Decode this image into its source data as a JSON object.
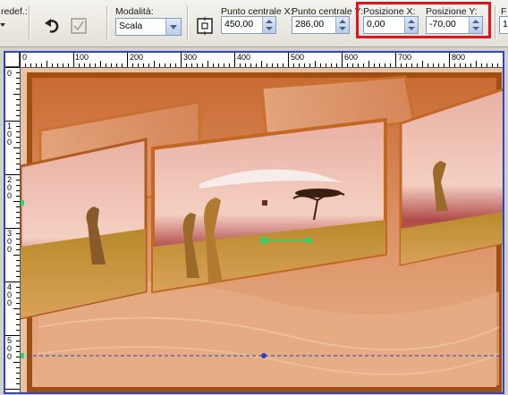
{
  "toolbar": {
    "preset_label": "redef.:",
    "mode_label": "Modalità:",
    "mode_value": "Scala",
    "center_x_label": "Punto centrale X:",
    "center_x_value": "450,00",
    "center_y_label": "Punto centrale Y:",
    "center_y_value": "286,00",
    "pos_x_label": "Posizione X:",
    "pos_x_value": "0,00",
    "pos_y_label": "Posizione Y:",
    "pos_y_value": "-70,00",
    "next_label": "F",
    "next_value": "1"
  },
  "ruler": {
    "h_ticks": [
      "0",
      "100",
      "200",
      "300",
      "400",
      "500",
      "600",
      "700",
      "800"
    ],
    "v_ticks": [
      "0",
      "100",
      "200",
      "300",
      "400",
      "500"
    ]
  },
  "colors": {
    "highlight": "#e4141e",
    "selection_border": "#2a45c8",
    "handle": "#2bd36a",
    "frame": "#c86a25"
  }
}
